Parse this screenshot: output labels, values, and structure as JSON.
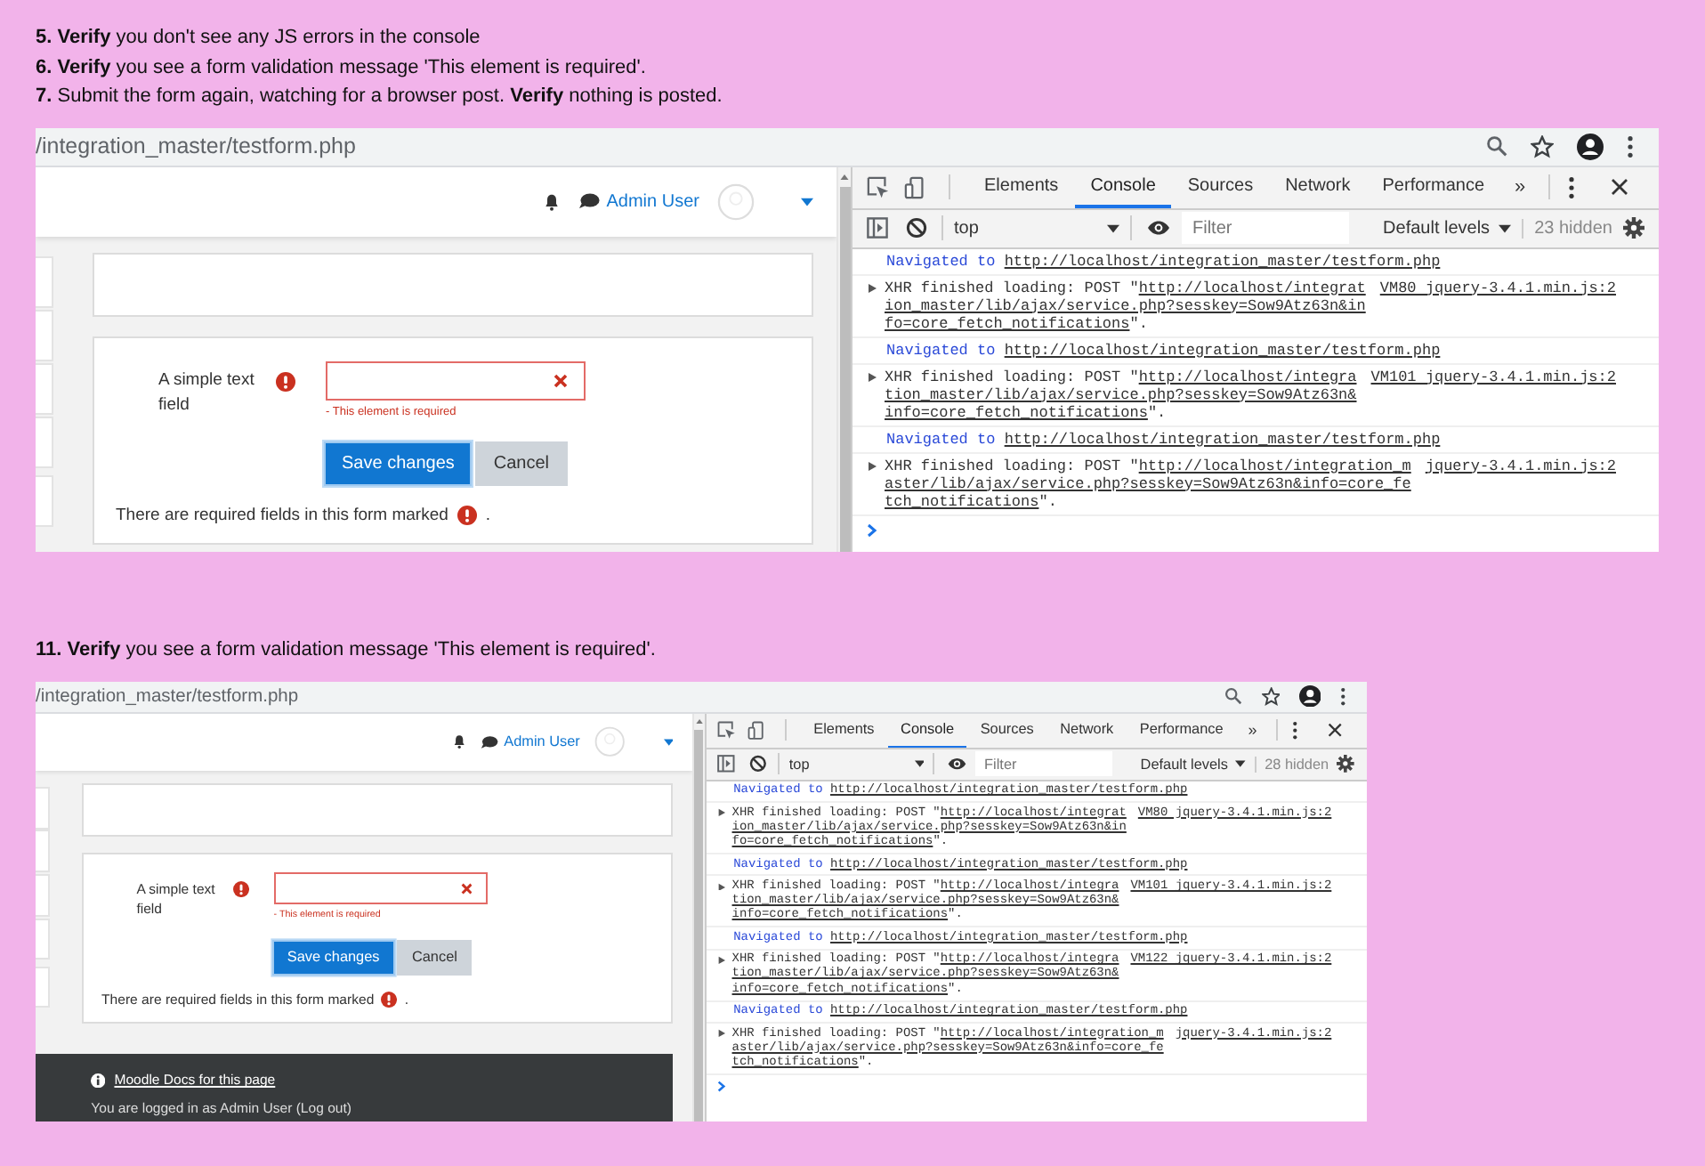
{
  "sections": [
    {
      "instructions": [
        "**5. Verify** you don't see any JS errors in the console",
        "**6. Verify** you see a form validation message 'This element is required'.",
        "**7.** Submit the form again, watching for a browser post. **Verify** nothing is posted."
      ],
      "screenshot": {
        "address": "/integration_master/testform.php",
        "page": {
          "user_name": "Admin User",
          "field_label": "A simple text field",
          "field_error": "- This element is required",
          "buttons": [
            {
              "label": "Save changes",
              "kind": "primary"
            },
            {
              "label": "Cancel",
              "kind": "secondary"
            }
          ],
          "required_note": "There are required fields in this form marked",
          "required_note_end": "."
        },
        "devtools": {
          "tabs": [
            {
              "label": "Elements",
              "selected": false
            },
            {
              "label": "Console",
              "selected": true
            },
            {
              "label": "Sources",
              "selected": false
            },
            {
              "label": "Network",
              "selected": false
            },
            {
              "label": "Performance",
              "selected": false
            }
          ],
          "more": "»",
          "context": "top",
          "filter_placeholder": "Filter",
          "levels": "Default levels",
          "hidden_count": "23 hidden",
          "messages": [
            {
              "kind": "navigated",
              "label": "Navigated to",
              "url": "http://localhost/integration_master/testform.php"
            },
            {
              "kind": "xhr",
              "message": "XHR finished loading: POST \"",
              "url": "http://localhost/integration_master/lib/ajax/service.php?sesskey=Sow9Atz63n&info=core_fetch_notifications",
              "end": "\".",
              "source": "VM80 jquery-3.4.1.min.js:2"
            },
            {
              "kind": "navigated",
              "label": "Navigated to",
              "url": "http://localhost/integration_master/testform.php"
            },
            {
              "kind": "xhr",
              "message": "XHR finished loading: POST \"",
              "url": "http://localhost/integration_master/lib/ajax/service.php?sesskey=Sow9Atz63n&info=core_fetch_notifications",
              "end": "\".",
              "source": "VM101 jquery-3.4.1.min.js:2"
            },
            {
              "kind": "navigated",
              "label": "Navigated to",
              "url": "http://localhost/integration_master/testform.php"
            },
            {
              "kind": "xhr",
              "message": "XHR finished loading: POST \"",
              "url": "http://localhost/integration_master/lib/ajax/service.php?sesskey=Sow9Atz63n&info=core_fetch_notifications",
              "end": "\".",
              "source": "jquery-3.4.1.min.js:2"
            }
          ]
        }
      }
    },
    {
      "instructions": [
        "**11. Verify** you see a form validation message 'This element is required'."
      ],
      "screenshot": {
        "address": "/integration_master/testform.php",
        "page": {
          "user_name": "Admin User",
          "field_label": "A simple text field",
          "field_error": "- This element is required",
          "buttons": [
            {
              "label": "Save changes",
              "kind": "primary"
            },
            {
              "label": "Cancel",
              "kind": "secondary"
            }
          ],
          "required_note": "There are required fields in this form marked",
          "required_note_end": ".",
          "footer": {
            "docs_link": "Moodle Docs for this page",
            "login_text": "You are logged in as Admin User (Log out)"
          }
        },
        "devtools": {
          "tabs": [
            {
              "label": "Elements",
              "selected": false
            },
            {
              "label": "Console",
              "selected": true
            },
            {
              "label": "Sources",
              "selected": false
            },
            {
              "label": "Network",
              "selected": false
            },
            {
              "label": "Performance",
              "selected": false
            }
          ],
          "more": "»",
          "context": "top",
          "filter_placeholder": "Filter",
          "levels": "Default levels",
          "hidden_count": "28 hidden",
          "messages": [
            {
              "kind": "navigated",
              "label": "Navigated to",
              "url": "http://localhost/integration_master/testform.php"
            },
            {
              "kind": "xhr",
              "message": "XHR finished loading: POST \"",
              "url": "http://localhost/integration_master/lib/ajax/service.php?sesskey=Sow9Atz63n&info=core_fetch_notifications",
              "end": "\".",
              "source": "VM80 jquery-3.4.1.min.js:2"
            },
            {
              "kind": "navigated",
              "label": "Navigated to",
              "url": "http://localhost/integration_master/testform.php"
            },
            {
              "kind": "xhr",
              "message": "XHR finished loading: POST \"",
              "url": "http://localhost/integration_master/lib/ajax/service.php?sesskey=Sow9Atz63n&info=core_fetch_notifications",
              "end": "\".",
              "source": "VM101 jquery-3.4.1.min.js:2"
            },
            {
              "kind": "navigated",
              "label": "Navigated to",
              "url": "http://localhost/integration_master/testform.php"
            },
            {
              "kind": "xhr",
              "message": "XHR finished loading: POST \"",
              "url": "http://localhost/integration_master/lib/ajax/service.php?sesskey=Sow9Atz63n&info=core_fetch_notifications",
              "end": "\".",
              "source": "VM122 jquery-3.4.1.min.js:2"
            },
            {
              "kind": "navigated",
              "label": "Navigated to",
              "url": "http://localhost/integration_master/testform.php"
            },
            {
              "kind": "xhr",
              "message": "XHR finished loading: POST \"",
              "url": "http://localhost/integration_master/lib/ajax/service.php?sesskey=Sow9Atz63n&info=core_fetch_notifications",
              "end": "\".",
              "source": "jquery-3.4.1.min.js:2"
            }
          ]
        }
      }
    }
  ]
}
